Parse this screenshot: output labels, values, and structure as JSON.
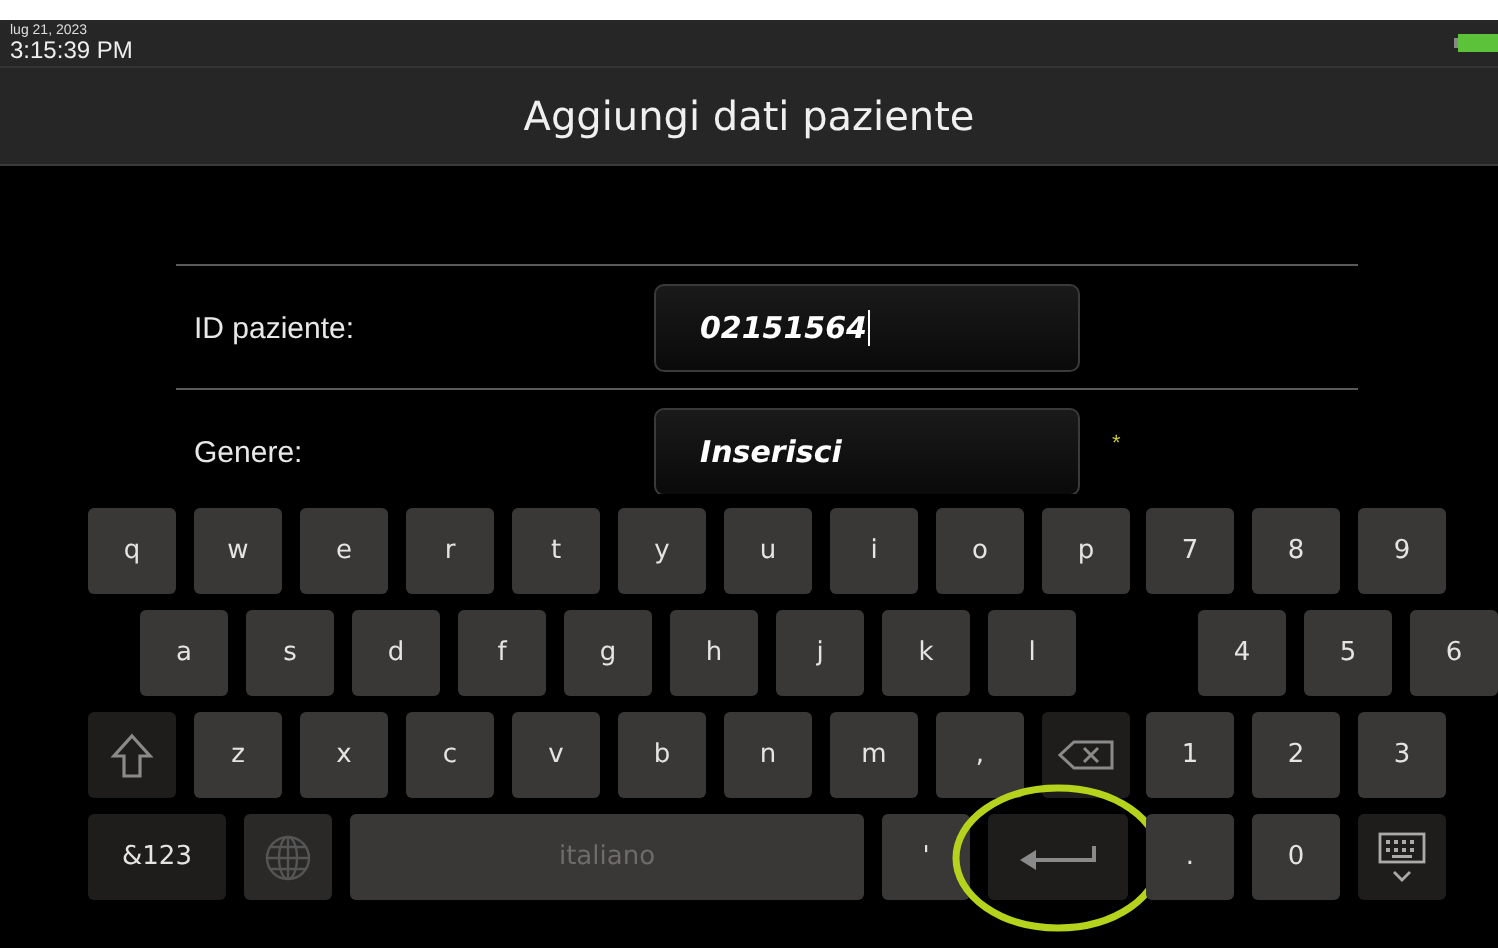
{
  "status_bar": {
    "date": "lug 21, 2023",
    "time": "3:15:39 PM"
  },
  "title": "Aggiungi dati paziente",
  "form": [
    {
      "label": "ID paziente:",
      "value": "02151564",
      "focused": true
    },
    {
      "label": "Genere:",
      "value": "Inserisci",
      "focused": false,
      "required_mark": "*"
    }
  ],
  "keyboard": {
    "rows": [
      {
        "indented": false,
        "letters": [
          {
            "kind": "char",
            "label": "q"
          },
          {
            "kind": "char",
            "label": "w"
          },
          {
            "kind": "char",
            "label": "e"
          },
          {
            "kind": "char",
            "label": "r"
          },
          {
            "kind": "char",
            "label": "t"
          },
          {
            "kind": "char",
            "label": "y"
          },
          {
            "kind": "char",
            "label": "u"
          },
          {
            "kind": "char",
            "label": "i"
          },
          {
            "kind": "char",
            "label": "o"
          },
          {
            "kind": "char",
            "label": "p"
          }
        ],
        "numbers": [
          {
            "kind": "char",
            "label": "7"
          },
          {
            "kind": "char",
            "label": "8"
          },
          {
            "kind": "char",
            "label": "9"
          }
        ]
      },
      {
        "indented": true,
        "letters": [
          {
            "kind": "char",
            "label": "a"
          },
          {
            "kind": "char",
            "label": "s"
          },
          {
            "kind": "char",
            "label": "d"
          },
          {
            "kind": "char",
            "label": "f"
          },
          {
            "kind": "char",
            "label": "g"
          },
          {
            "kind": "char",
            "label": "h"
          },
          {
            "kind": "char",
            "label": "j"
          },
          {
            "kind": "char",
            "label": "k"
          },
          {
            "kind": "char",
            "label": "l"
          }
        ],
        "numbers": [
          {
            "kind": "char",
            "label": "4"
          },
          {
            "kind": "char",
            "label": "5"
          },
          {
            "kind": "char",
            "label": "6"
          }
        ]
      },
      {
        "indented": false,
        "letters": [
          {
            "kind": "shift"
          },
          {
            "kind": "char",
            "label": "z"
          },
          {
            "kind": "char",
            "label": "x"
          },
          {
            "kind": "char",
            "label": "c"
          },
          {
            "kind": "char",
            "label": "v"
          },
          {
            "kind": "char",
            "label": "b"
          },
          {
            "kind": "char",
            "label": "n"
          },
          {
            "kind": "char",
            "label": "m"
          },
          {
            "kind": "char",
            "label": ","
          },
          {
            "kind": "backspace"
          }
        ],
        "numbers": [
          {
            "kind": "char",
            "label": "1"
          },
          {
            "kind": "char",
            "label": "2"
          },
          {
            "kind": "char",
            "label": "3"
          }
        ]
      },
      {
        "indented": false,
        "letters": [
          {
            "kind": "symbols",
            "label": "&123"
          },
          {
            "kind": "globe"
          },
          {
            "kind": "space",
            "label": "italiano"
          },
          {
            "kind": "char",
            "label": "'"
          },
          {
            "kind": "enter",
            "highlighted": true
          }
        ],
        "numbers": [
          {
            "kind": "char",
            "label": "."
          },
          {
            "kind": "char",
            "label": "0"
          },
          {
            "kind": "hide"
          }
        ]
      }
    ]
  }
}
